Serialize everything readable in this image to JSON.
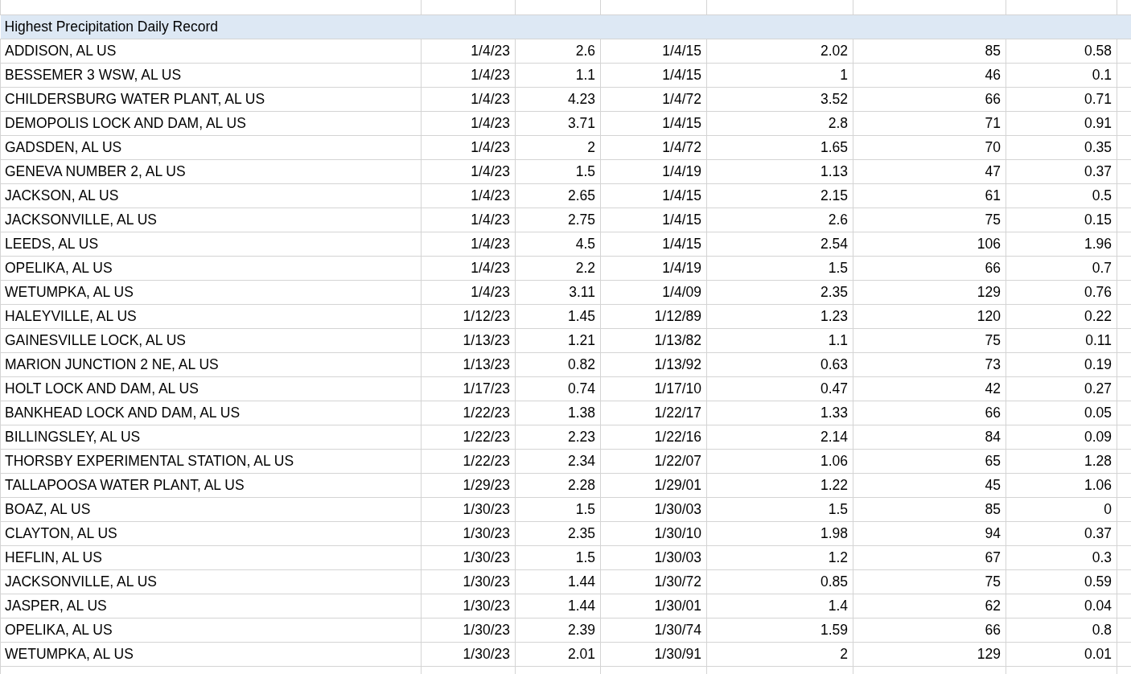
{
  "table": {
    "title": "Highest Precipitation Daily Record",
    "rows": [
      [
        "ADDISON, AL US",
        "1/4/23",
        "2.6",
        "1/4/15",
        "2.02",
        "85",
        "0.58"
      ],
      [
        "BESSEMER 3 WSW, AL US",
        "1/4/23",
        "1.1",
        "1/4/15",
        "1",
        "46",
        "0.1"
      ],
      [
        "CHILDERSBURG WATER PLANT, AL US",
        "1/4/23",
        "4.23",
        "1/4/72",
        "3.52",
        "66",
        "0.71"
      ],
      [
        "DEMOPOLIS LOCK AND DAM, AL US",
        "1/4/23",
        "3.71",
        "1/4/15",
        "2.8",
        "71",
        "0.91"
      ],
      [
        "GADSDEN, AL US",
        "1/4/23",
        "2",
        "1/4/72",
        "1.65",
        "70",
        "0.35"
      ],
      [
        "GENEVA NUMBER 2, AL US",
        "1/4/23",
        "1.5",
        "1/4/19",
        "1.13",
        "47",
        "0.37"
      ],
      [
        "JACKSON, AL US",
        "1/4/23",
        "2.65",
        "1/4/15",
        "2.15",
        "61",
        "0.5"
      ],
      [
        "JACKSONVILLE, AL US",
        "1/4/23",
        "2.75",
        "1/4/15",
        "2.6",
        "75",
        "0.15"
      ],
      [
        "LEEDS, AL US",
        "1/4/23",
        "4.5",
        "1/4/15",
        "2.54",
        "106",
        "1.96"
      ],
      [
        "OPELIKA, AL US",
        "1/4/23",
        "2.2",
        "1/4/19",
        "1.5",
        "66",
        "0.7"
      ],
      [
        "WETUMPKA, AL US",
        "1/4/23",
        "3.11",
        "1/4/09",
        "2.35",
        "129",
        "0.76"
      ],
      [
        "HALEYVILLE, AL US",
        "1/12/23",
        "1.45",
        "1/12/89",
        "1.23",
        "120",
        "0.22"
      ],
      [
        "GAINESVILLE LOCK, AL US",
        "1/13/23",
        "1.21",
        "1/13/82",
        "1.1",
        "75",
        "0.11"
      ],
      [
        "MARION JUNCTION 2 NE, AL US",
        "1/13/23",
        "0.82",
        "1/13/92",
        "0.63",
        "73",
        "0.19"
      ],
      [
        "HOLT LOCK AND DAM, AL US",
        "1/17/23",
        "0.74",
        "1/17/10",
        "0.47",
        "42",
        "0.27"
      ],
      [
        "BANKHEAD LOCK AND DAM, AL US",
        "1/22/23",
        "1.38",
        "1/22/17",
        "1.33",
        "66",
        "0.05"
      ],
      [
        "BILLINGSLEY, AL US",
        "1/22/23",
        "2.23",
        "1/22/16",
        "2.14",
        "84",
        "0.09"
      ],
      [
        "THORSBY EXPERIMENTAL STATION, AL US",
        "1/22/23",
        "2.34",
        "1/22/07",
        "1.06",
        "65",
        "1.28"
      ],
      [
        "TALLAPOOSA WATER PLANT, AL US",
        "1/29/23",
        "2.28",
        "1/29/01",
        "1.22",
        "45",
        "1.06"
      ],
      [
        "BOAZ, AL US",
        "1/30/23",
        "1.5",
        "1/30/03",
        "1.5",
        "85",
        "0"
      ],
      [
        "CLAYTON, AL US",
        "1/30/23",
        "2.35",
        "1/30/10",
        "1.98",
        "94",
        "0.37"
      ],
      [
        "HEFLIN, AL US",
        "1/30/23",
        "1.5",
        "1/30/03",
        "1.2",
        "67",
        "0.3"
      ],
      [
        "JACKSONVILLE, AL US",
        "1/30/23",
        "1.44",
        "1/30/72",
        "0.85",
        "75",
        "0.59"
      ],
      [
        "JASPER, AL US",
        "1/30/23",
        "1.44",
        "1/30/01",
        "1.4",
        "62",
        "0.04"
      ],
      [
        "OPELIKA, AL US",
        "1/30/23",
        "2.39",
        "1/30/74",
        "1.59",
        "66",
        "0.8"
      ],
      [
        "WETUMPKA, AL US",
        "1/30/23",
        "2.01",
        "1/30/91",
        "2",
        "129",
        "0.01"
      ]
    ]
  }
}
